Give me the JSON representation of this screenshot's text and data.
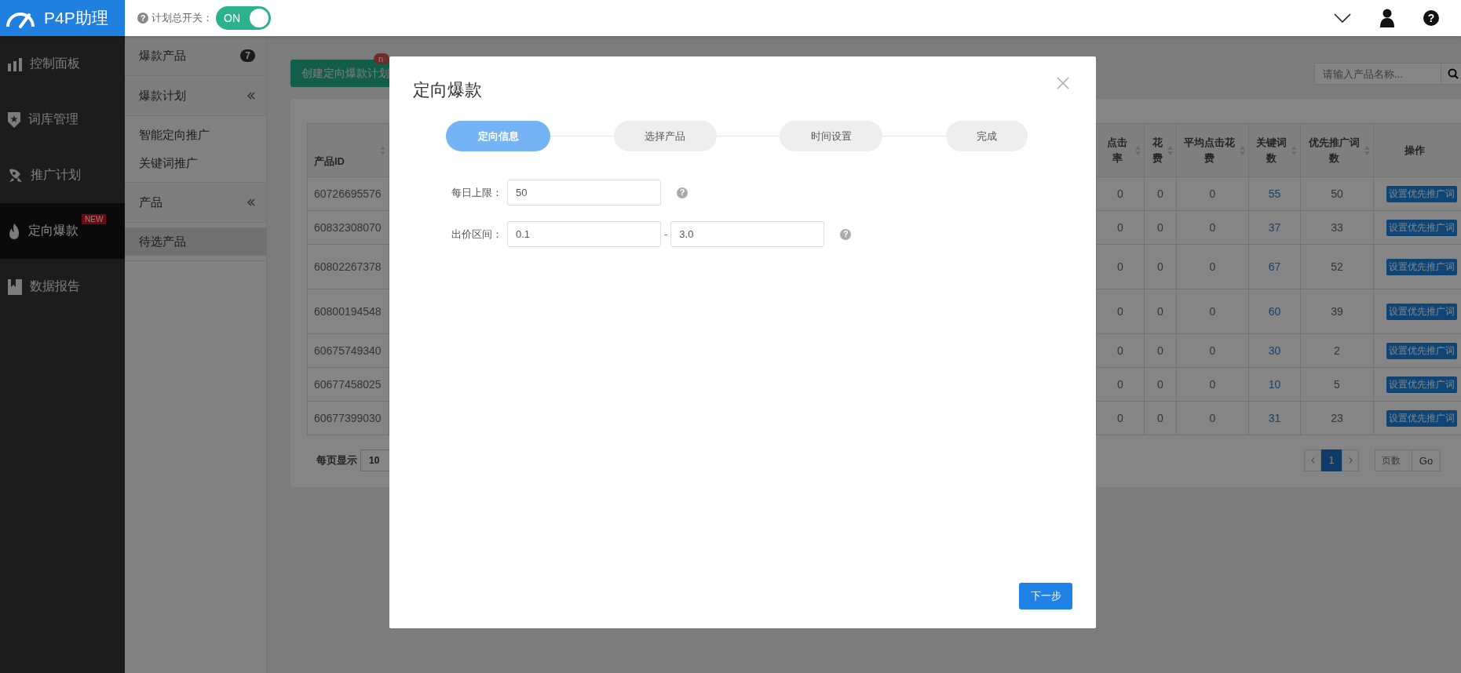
{
  "logo": {
    "title": "P4P助理"
  },
  "header": {
    "switch_help": "?",
    "switch_label": "计划总开关：",
    "switch": {
      "label": "ON",
      "on": true
    },
    "help": "?"
  },
  "sidebar": {
    "items": [
      {
        "label": "控制面板",
        "kind": "chart",
        "selected": false
      },
      {
        "label": "词库管理",
        "kind": "shield",
        "selected": false
      },
      {
        "label": "推广计划",
        "kind": "rocket",
        "selected": false
      },
      {
        "label": "定向爆款",
        "kind": "flame",
        "selected": true,
        "badge": "NEW"
      },
      {
        "label": "数据报告",
        "kind": "report",
        "selected": false
      }
    ]
  },
  "submenu": [
    {
      "label": "爆款产品",
      "count": "7",
      "collapsible": false
    },
    {
      "label": "爆款计划",
      "collapsible": true,
      "children": [
        {
          "label": "智能定向推广",
          "selected": false
        },
        {
          "label": "关键词推广",
          "selected": false
        }
      ]
    },
    {
      "label": "产品",
      "collapsible": true,
      "children": [
        {
          "label": "待选产品",
          "selected": true
        }
      ]
    }
  ],
  "toolbar": {
    "create_button": "创建定向爆款计划",
    "create_badge": "n",
    "search": {
      "placeholder": "请输入产品名称..."
    }
  },
  "table": {
    "columns": [
      {
        "label": "产品ID",
        "sortable": true
      },
      {
        "label": "点击率",
        "sortable": true
      },
      {
        "label": "花费",
        "sortable": true
      },
      {
        "label": "平均点击花费",
        "sortable": true
      },
      {
        "label": "关键词数",
        "sortable": true
      },
      {
        "label": "优先推广词数",
        "sortable": true
      },
      {
        "label": "操作",
        "sortable": false
      }
    ],
    "rows": [
      {
        "product_id": "60726695576",
        "click_rate": "0",
        "cost": "0",
        "avg_click_cost": "0",
        "keyword_count": "55",
        "priority_count": "50",
        "action": "设置优先推广词",
        "tall": false
      },
      {
        "product_id": "60832308070",
        "click_rate": "0",
        "cost": "0",
        "avg_click_cost": "0",
        "keyword_count": "37",
        "priority_count": "33",
        "action": "设置优先推广词",
        "tall": false
      },
      {
        "product_id": "60802267378",
        "click_rate": "0",
        "cost": "0",
        "avg_click_cost": "0",
        "keyword_count": "67",
        "priority_count": "52",
        "action": "设置优先推广词",
        "tall": true
      },
      {
        "product_id": "60800194548",
        "click_rate": "0",
        "cost": "0",
        "avg_click_cost": "0",
        "keyword_count": "60",
        "priority_count": "39",
        "action": "设置优先推广词",
        "tall": true
      },
      {
        "product_id": "60675749340",
        "click_rate": "0",
        "cost": "0",
        "avg_click_cost": "0",
        "keyword_count": "30",
        "priority_count": "2",
        "action": "设置优先推广词",
        "tall": false
      },
      {
        "product_id": "60677458025",
        "click_rate": "0",
        "cost": "0",
        "avg_click_cost": "0",
        "keyword_count": "10",
        "priority_count": "5",
        "action": "设置优先推广词",
        "tall": false
      },
      {
        "product_id": "60677399030",
        "click_rate": "0",
        "cost": "0",
        "avg_click_cost": "0",
        "keyword_count": "31",
        "priority_count": "23",
        "action": "设置优先推广词",
        "tall": false
      }
    ]
  },
  "pagination": {
    "per_page_label": "每页显示",
    "per_page": "10",
    "pages": [
      {
        "label": "1",
        "selected": true
      }
    ],
    "page_input": {
      "placeholder": "页数"
    },
    "go_button": "Go"
  },
  "modal": {
    "title": "定向爆款",
    "steps": [
      {
        "label": "定向信息",
        "selected": true
      },
      {
        "label": "选择产品",
        "selected": false
      },
      {
        "label": "时间设置",
        "selected": false
      },
      {
        "label": "完成",
        "selected": false
      }
    ],
    "fields": [
      {
        "label": "每日上限：",
        "kind": "single",
        "value": "50",
        "help": "?"
      },
      {
        "label": "出价区间：",
        "kind": "range",
        "value": "0.1",
        "separator": "-",
        "value_to": "3.0",
        "help": "?"
      }
    ],
    "next_button": "下一步"
  }
}
